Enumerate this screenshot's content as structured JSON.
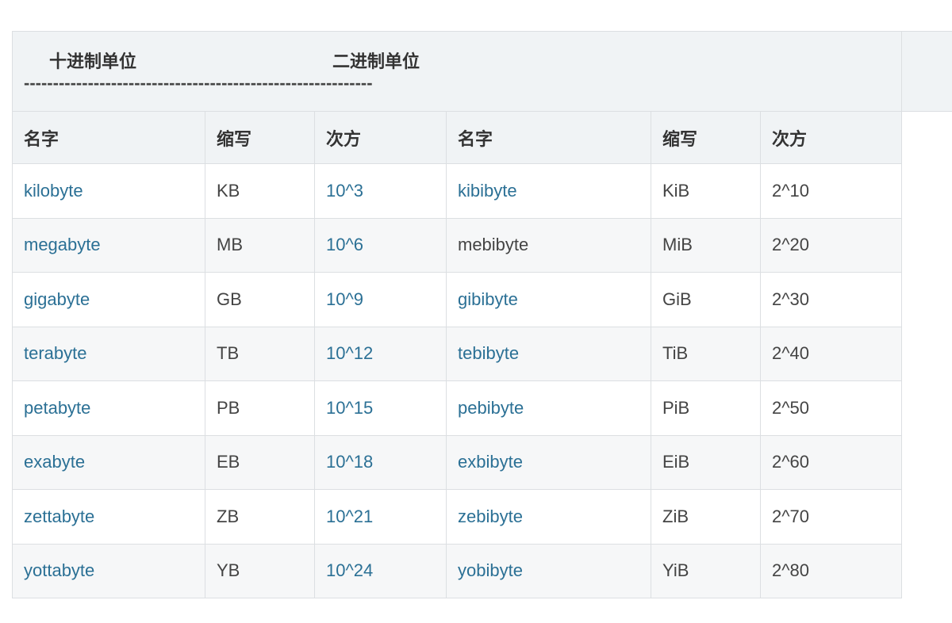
{
  "caption": {
    "decimal_label": "十进制单位",
    "binary_label": "二进制单位",
    "dashes": "------------------------------------------------------------"
  },
  "table": {
    "headers": [
      "名字",
      "缩写",
      "次方",
      "名字",
      "缩写",
      "次方"
    ],
    "rows": [
      {
        "dec_name": "kilobyte",
        "dec_abbr": "KB",
        "dec_power": "10^3",
        "bin_name": "kibibyte",
        "bin_abbr": "KiB",
        "bin_power": "2^10"
      },
      {
        "dec_name": "megabyte",
        "dec_abbr": "MB",
        "dec_power": "10^6",
        "bin_name": "mebibyte",
        "bin_abbr": "MiB",
        "bin_power": "2^20"
      },
      {
        "dec_name": "gigabyte",
        "dec_abbr": "GB",
        "dec_power": "10^9",
        "bin_name": "gibibyte",
        "bin_abbr": "GiB",
        "bin_power": "2^30"
      },
      {
        "dec_name": "terabyte",
        "dec_abbr": "TB",
        "dec_power": "10^12",
        "bin_name": "tebibyte",
        "bin_abbr": "TiB",
        "bin_power": "2^40"
      },
      {
        "dec_name": "petabyte",
        "dec_abbr": "PB",
        "dec_power": "10^15",
        "bin_name": "pebibyte",
        "bin_abbr": "PiB",
        "bin_power": "2^50"
      },
      {
        "dec_name": "exabyte",
        "dec_abbr": "EB",
        "dec_power": "10^18",
        "bin_name": "exbibyte",
        "bin_abbr": "EiB",
        "bin_power": "2^60"
      },
      {
        "dec_name": "zettabyte",
        "dec_abbr": "ZB",
        "dec_power": "10^21",
        "bin_name": "zebibyte",
        "bin_abbr": "ZiB",
        "bin_power": "2^70"
      },
      {
        "dec_name": "yottabyte",
        "dec_abbr": "YB",
        "dec_power": "10^24",
        "bin_name": "yobibyte",
        "bin_abbr": "YiB",
        "bin_power": "2^80"
      }
    ]
  },
  "colors": {
    "link": "#2b7095",
    "text": "#444444",
    "header_bg": "#f0f3f5",
    "border": "#dcdfe2"
  }
}
